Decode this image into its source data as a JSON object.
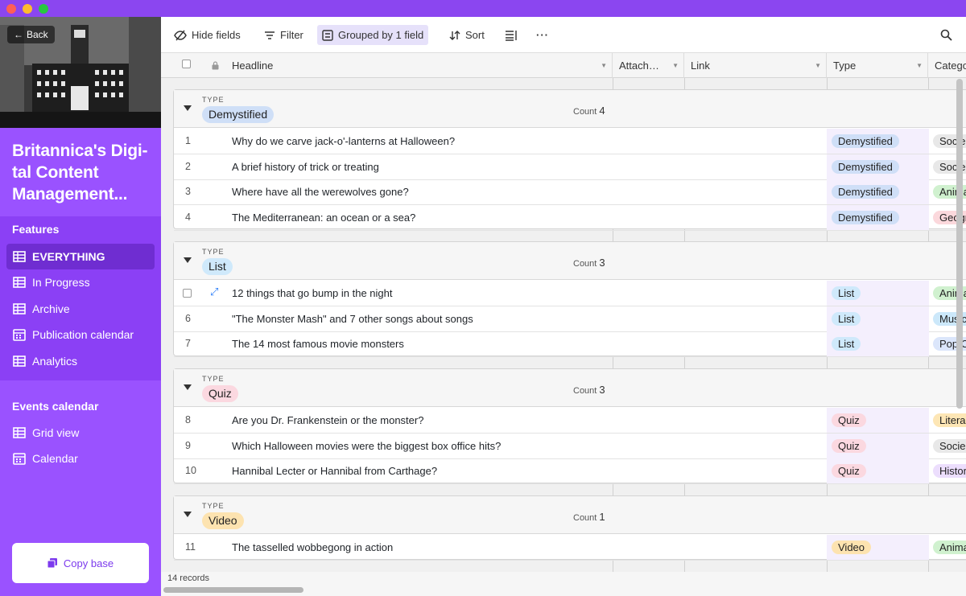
{
  "window": {
    "traffic_lights": [
      "close",
      "minimize",
      "zoom"
    ]
  },
  "sidebar": {
    "back_label": "Back",
    "base_title": "Britannica's Digi- tal Content Management...",
    "features_heading": "Features",
    "items": [
      {
        "label": "EVERYTHING",
        "icon": "grid-icon",
        "active": true
      },
      {
        "label": "In Progress",
        "icon": "grid-icon",
        "active": false
      },
      {
        "label": "Archive",
        "icon": "grid-icon",
        "active": false
      },
      {
        "label": "Publication calendar",
        "icon": "calendar-icon",
        "active": false
      },
      {
        "label": "Analytics",
        "icon": "grid-icon",
        "active": false
      }
    ],
    "events_heading": "Events calendar",
    "events_items": [
      {
        "label": "Grid view",
        "icon": "grid-icon"
      },
      {
        "label": "Calendar",
        "icon": "calendar-icon"
      }
    ],
    "copy_base_label": "Copy base"
  },
  "toolbar": {
    "hide_fields": "Hide fields",
    "filter": "Filter",
    "grouped": "Grouped by 1 field",
    "sort": "Sort"
  },
  "columns": {
    "headline": "Headline",
    "attach": "Attach…",
    "link": "Link",
    "type": "Type",
    "category": "Catego"
  },
  "groups": [
    {
      "type_label": "TYPE",
      "value": "Demystified",
      "pill": "p-dem",
      "count_label": "Count",
      "count": "4",
      "rows": [
        {
          "num": "1",
          "headline": "Why do we carve jack-o'-lanterns at Halloween?",
          "type": "Demystified",
          "category": "Socie",
          "cat_pill": "p-soc"
        },
        {
          "num": "2",
          "headline": "A brief history of trick or treating",
          "type": "Demystified",
          "category": "Socie",
          "cat_pill": "p-soc"
        },
        {
          "num": "3",
          "headline": "Where have all the werewolves gone?",
          "type": "Demystified",
          "category": "Anima",
          "cat_pill": "p-ani"
        },
        {
          "num": "4",
          "headline": "The Mediterranean: an ocean or a sea?",
          "type": "Demystified",
          "category": "Geogr",
          "cat_pill": "p-geo"
        }
      ]
    },
    {
      "type_label": "TYPE",
      "value": "List",
      "pill": "p-list",
      "count_label": "Count",
      "count": "3",
      "rows": [
        {
          "num": "",
          "headline": "12 things that go bump in the night",
          "type": "List",
          "category": "Anima",
          "cat_pill": "p-ani",
          "hover": true
        },
        {
          "num": "6",
          "headline": "\"The Monster Mash\" and 7 other songs about songs",
          "type": "List",
          "category": "Music",
          "cat_pill": "p-mus"
        },
        {
          "num": "7",
          "headline": "The 14 most famous movie monsters",
          "type": "List",
          "category": "Pop C",
          "cat_pill": "p-pop"
        }
      ]
    },
    {
      "type_label": "TYPE",
      "value": "Quiz",
      "pill": "p-quiz",
      "count_label": "Count",
      "count": "3",
      "rows": [
        {
          "num": "8",
          "headline": "Are you Dr. Frankenstein or the monster?",
          "type": "Quiz",
          "category": "Litera",
          "cat_pill": "p-lit"
        },
        {
          "num": "9",
          "headline": "Which Halloween movies were the biggest box office hits?",
          "type": "Quiz",
          "category": "Socie",
          "cat_pill": "p-soc"
        },
        {
          "num": "10",
          "headline": "Hannibal Lecter or Hannibal from Carthage?",
          "type": "Quiz",
          "category": "Histor",
          "cat_pill": "p-his"
        }
      ]
    },
    {
      "type_label": "TYPE",
      "value": "Video",
      "pill": "p-video",
      "count_label": "Count",
      "count": "1",
      "rows": [
        {
          "num": "11",
          "headline": "The tasselled wobbegong in action",
          "type": "Video",
          "category": "Anima",
          "cat_pill": "p-ani"
        }
      ]
    }
  ],
  "footer": {
    "records": "14 records"
  },
  "colors": {
    "accent": "#8b46f0",
    "sidebar": "#9a52ff",
    "active_nav": "#6f2dd1"
  }
}
